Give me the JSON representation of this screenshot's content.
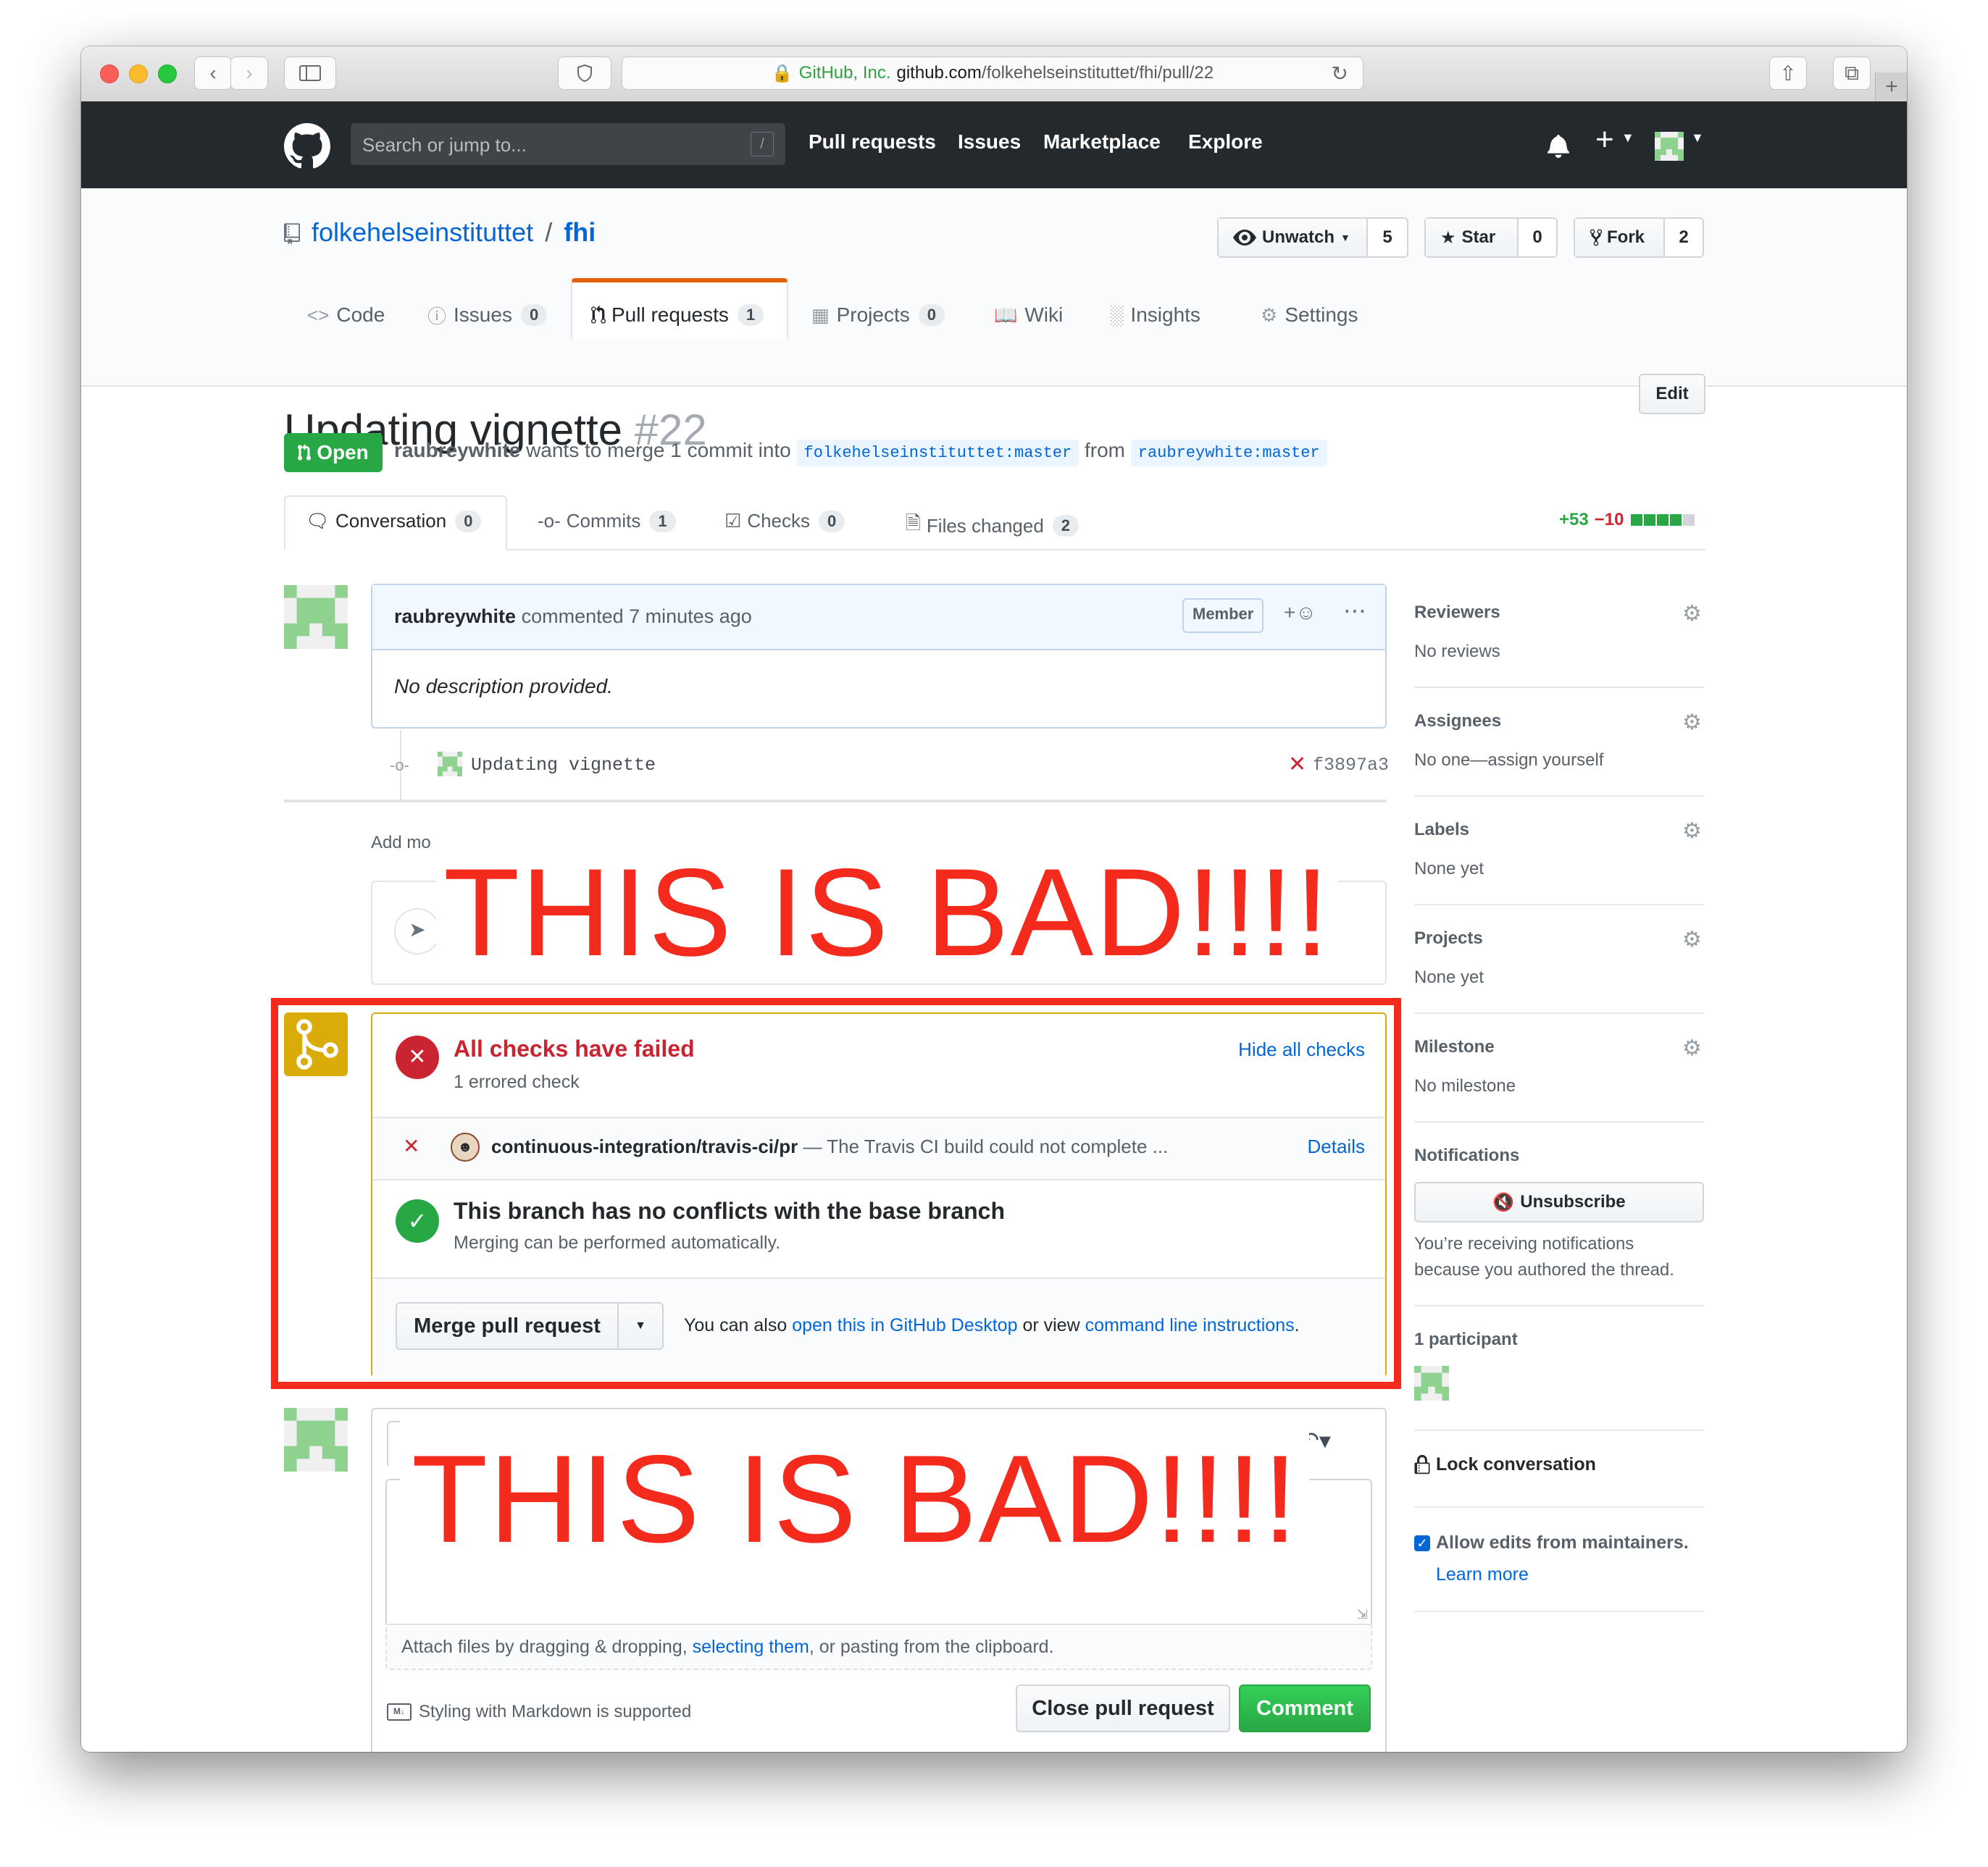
{
  "browser": {
    "url_company": "GitHub, Inc.",
    "url_host": "github.com",
    "url_path": "/folkehelseinstituttet/fhi/pull/22"
  },
  "header": {
    "search_placeholder": "Search or jump to...",
    "search_shortcut": "/",
    "nav": [
      "Pull requests",
      "Issues",
      "Marketplace",
      "Explore"
    ]
  },
  "repo": {
    "owner": "folkehelseinstituttet",
    "separator": "/",
    "name": "fhi",
    "watch_label": "Unwatch",
    "watch_count": "5",
    "star_label": "Star",
    "star_count": "0",
    "fork_label": "Fork",
    "fork_count": "2",
    "tabs": [
      {
        "label": "Code",
        "count": ""
      },
      {
        "label": "Issues",
        "count": "0"
      },
      {
        "label": "Pull requests",
        "count": "1"
      },
      {
        "label": "Projects",
        "count": "0"
      },
      {
        "label": "Wiki",
        "count": ""
      },
      {
        "label": "Insights",
        "count": ""
      },
      {
        "label": "Settings",
        "count": ""
      }
    ]
  },
  "pr": {
    "title": "Updating vignette",
    "number": "#22",
    "edit_label": "Edit",
    "state": "Open",
    "author": "raubreywhite",
    "merge_text": "wants to merge 1 commit into",
    "base_branch": "folkehelseinstituttet:master",
    "from_text": "from",
    "head_branch": "raubreywhite:master",
    "tabs": [
      {
        "label": "Conversation",
        "count": "0"
      },
      {
        "label": "Commits",
        "count": "1"
      },
      {
        "label": "Checks",
        "count": "0"
      },
      {
        "label": "Files changed",
        "count": "2"
      }
    ],
    "additions": "+53",
    "deletions": "−10",
    "diffstat": [
      1,
      1,
      1,
      1,
      0
    ]
  },
  "comment": {
    "author": "raubreywhite",
    "meta": "commented 7 minutes ago",
    "role": "Member",
    "body": "No description provided."
  },
  "commit": {
    "message": "Updating vignette",
    "sha": "f3897a3"
  },
  "add_more_label": "Add mo",
  "overlay_text": "THIS IS BAD!!!!",
  "merge_box": {
    "checks_title": "All checks have failed",
    "checks_sub": "1 errored check",
    "hide_checks": "Hide all checks",
    "check_name": "continuous-integration/travis-ci/pr",
    "check_desc": "— The Travis CI build could not complete ...",
    "details": "Details",
    "conflict_title": "This branch has no conflicts with the base branch",
    "conflict_sub": "Merging can be performed automatically.",
    "merge_button": "Merge pull request",
    "also_text": "You can also",
    "open_desktop": "open this in GitHub Desktop",
    "or_view": "or view",
    "cli_instructions": "command line instructions",
    "period": "."
  },
  "new_comment": {
    "attach_text_1": "Attach files by dragging & dropping,",
    "attach_link": "selecting them",
    "attach_text_2": ", or pasting from the clipboard.",
    "markdown_note": "Styling with Markdown is supported",
    "close_button": "Close pull request",
    "comment_button": "Comment"
  },
  "sidebar": {
    "reviewers_h": "Reviewers",
    "reviewers_v": "No reviews",
    "assignees_h": "Assignees",
    "assignees_v": "No one—assign yourself",
    "labels_h": "Labels",
    "labels_v": "None yet",
    "projects_h": "Projects",
    "projects_v": "None yet",
    "milestone_h": "Milestone",
    "milestone_v": "No milestone",
    "notifications_h": "Notifications",
    "unsubscribe": "Unsubscribe",
    "notif_reason_1": "You’re receiving notifications",
    "notif_reason_2": "because you authored the thread.",
    "participants_h": "1 participant",
    "lock": "Lock conversation",
    "allow_edits": "Allow edits from maintainers.",
    "learn_more": "Learn more"
  },
  "colors": {
    "header_bg": "#24292e",
    "open_green": "#28a745",
    "link_blue": "#0366d6",
    "fail_red": "#cb2431",
    "merge_yellow": "#dbab09",
    "annotation_red": "#f42a1d"
  }
}
